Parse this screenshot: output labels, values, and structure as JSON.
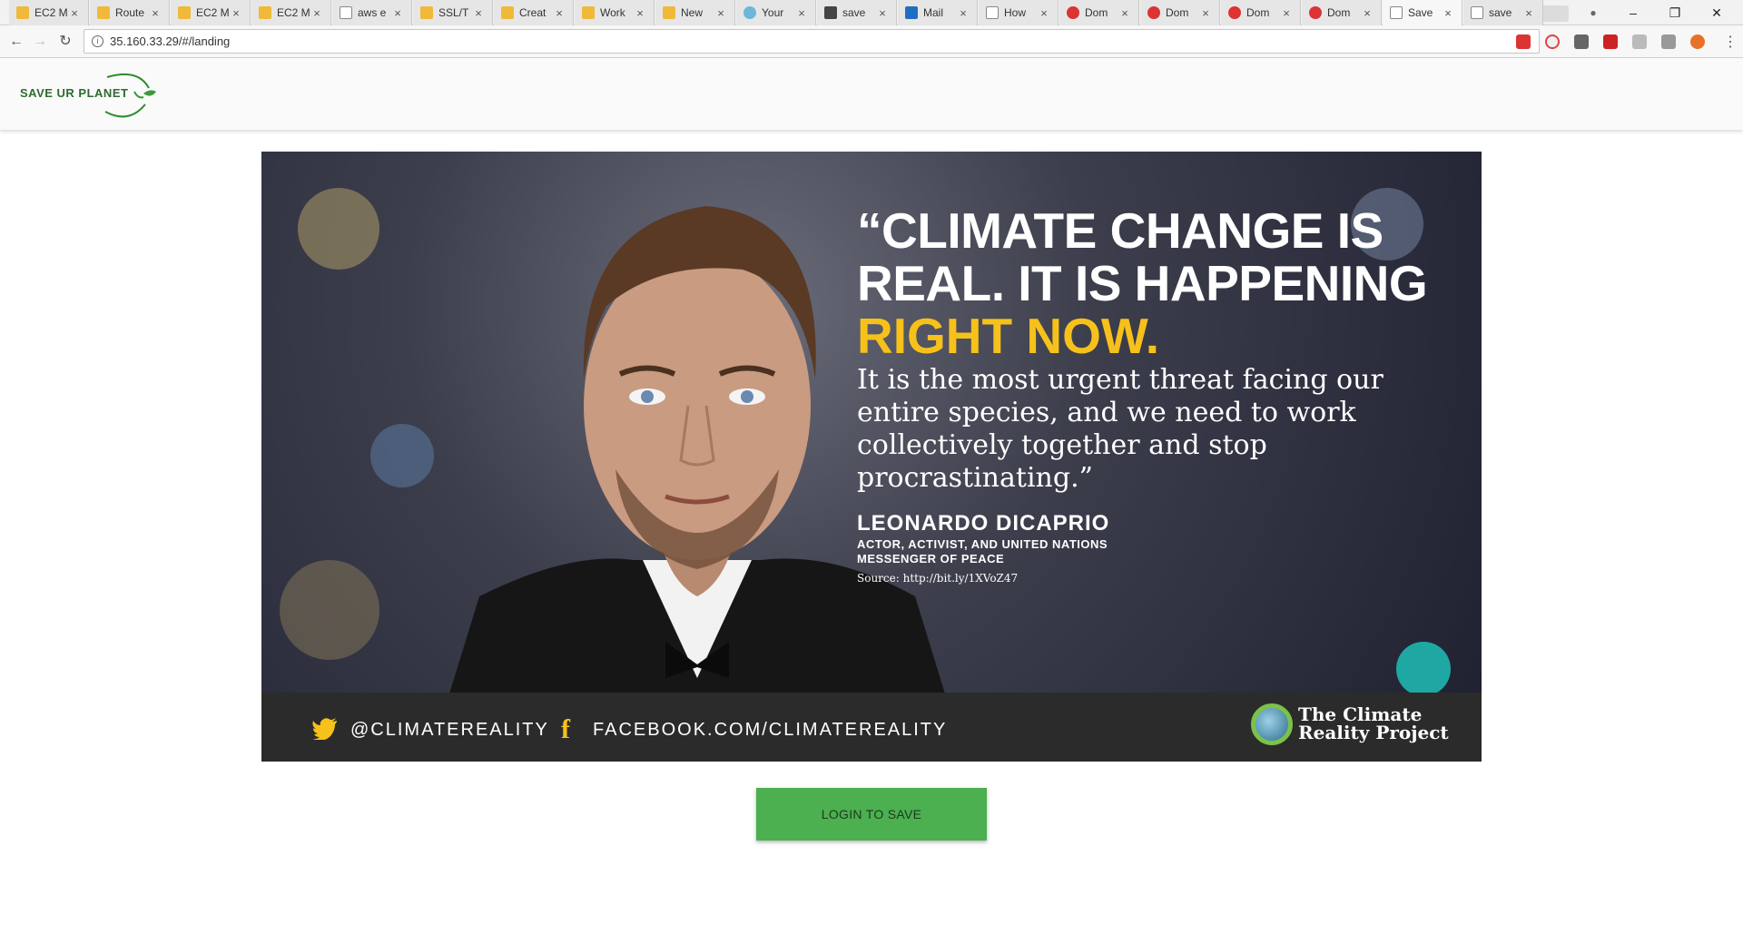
{
  "browser": {
    "tabs": [
      {
        "label": "EC2 M",
        "icon": "aws-icon"
      },
      {
        "label": "Route",
        "icon": "aws-icon"
      },
      {
        "label": "EC2 M",
        "icon": "aws-icon"
      },
      {
        "label": "EC2 M",
        "icon": "aws-icon"
      },
      {
        "label": "aws e",
        "icon": "google-icon"
      },
      {
        "label": "SSL/T",
        "icon": "aws-icon"
      },
      {
        "label": "Creat",
        "icon": "aws-icon"
      },
      {
        "label": "Work",
        "icon": "aws-icon"
      },
      {
        "label": "New",
        "icon": "aws-icon"
      },
      {
        "label": "Your",
        "icon": "globe-icon"
      },
      {
        "label": "save",
        "icon": "github-icon"
      },
      {
        "label": "Mail",
        "icon": "outlook-icon"
      },
      {
        "label": "How",
        "icon": "google-icon"
      },
      {
        "label": "Dom",
        "icon": "domain-icon"
      },
      {
        "label": "Dom",
        "icon": "domain-icon"
      },
      {
        "label": "Dom",
        "icon": "domain-icon"
      },
      {
        "label": "Dom",
        "icon": "domain-icon"
      },
      {
        "label": "Save",
        "icon": "page-icon",
        "active": true
      },
      {
        "label": "save",
        "icon": "page-icon"
      }
    ],
    "url": "35.160.33.29/#/landing"
  },
  "app": {
    "logo_text": "SAVE UR PLANET",
    "banner": {
      "headline": "“CLIMATE CHANGE IS REAL. IT IS HAPPENING",
      "highlight": "RIGHT NOW.",
      "body": "It is the most urgent threat facing our entire species, and we need to work collectively together and stop procrastinating.”",
      "author": "LEONARDO DICAPRIO",
      "role": "ACTOR, ACTIVIST, AND UNITED NATIONS MESSENGER OF PEACE",
      "source": "Source: http://bit.ly/1XVoZ47",
      "twitter": "@CLIMATEREALITY",
      "facebook": "FACEBOOK.COM/CLIMATEREALITY",
      "org": "The Climate Reality Project"
    },
    "login_label": "LOGIN TO SAVE"
  },
  "colors": {
    "accent": "#4caf50",
    "highlight": "#f7c11b"
  }
}
